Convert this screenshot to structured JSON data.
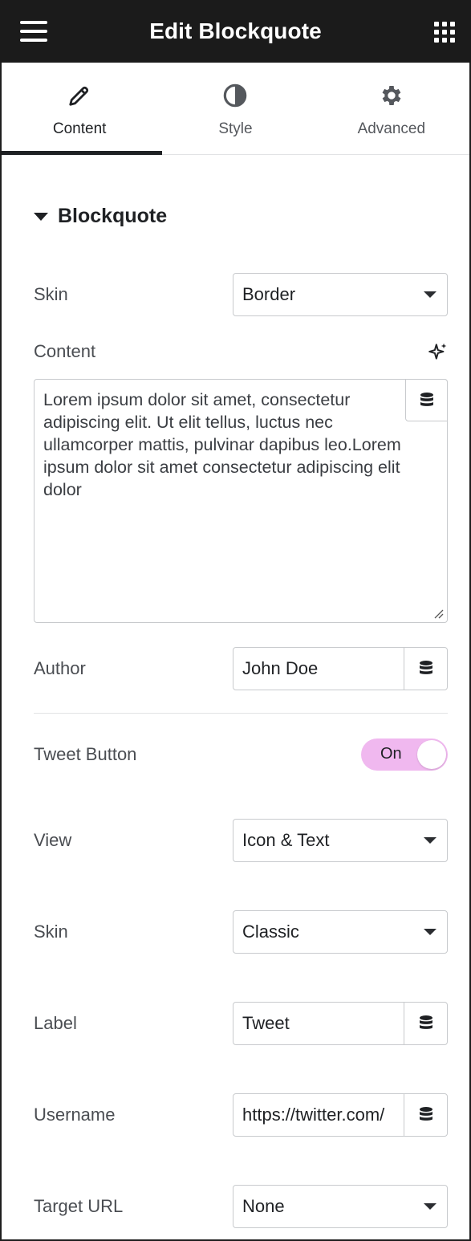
{
  "header": {
    "title": "Edit Blockquote",
    "menu_icon": "hamburger-menu-icon",
    "apps_icon": "apps-grid-icon"
  },
  "tabs": [
    {
      "label": "Content",
      "icon": "pencil-icon",
      "active": true
    },
    {
      "label": "Style",
      "icon": "half-circle-contrast-icon",
      "active": false
    },
    {
      "label": "Advanced",
      "icon": "gear-icon",
      "active": false
    }
  ],
  "section": {
    "title": "Blockquote"
  },
  "fields": {
    "skin": {
      "label": "Skin",
      "value": "Border"
    },
    "content": {
      "label": "Content",
      "value": "Lorem ipsum dolor sit amet, consectetur adipiscing elit. Ut elit tellus, luctus nec ullamcorper mattis, pulvinar dapibus leo.Lorem ipsum dolor sit amet consectetur adipiscing elit dolor"
    },
    "author": {
      "label": "Author",
      "value": "John Doe"
    },
    "tweet_button": {
      "label": "Tweet Button",
      "state": "On"
    },
    "view": {
      "label": "View",
      "value": "Icon & Text"
    },
    "tweet_skin": {
      "label": "Skin",
      "value": "Classic"
    },
    "tweet_label": {
      "label": "Label",
      "value": "Tweet"
    },
    "username": {
      "label": "Username",
      "value": "https://twitter.com/"
    },
    "target_url": {
      "label": "Target URL",
      "value": "None"
    }
  },
  "colors": {
    "header_bg": "#1b1b1b",
    "toggle_on": "#f0b8ef",
    "text": "#1f2124"
  }
}
